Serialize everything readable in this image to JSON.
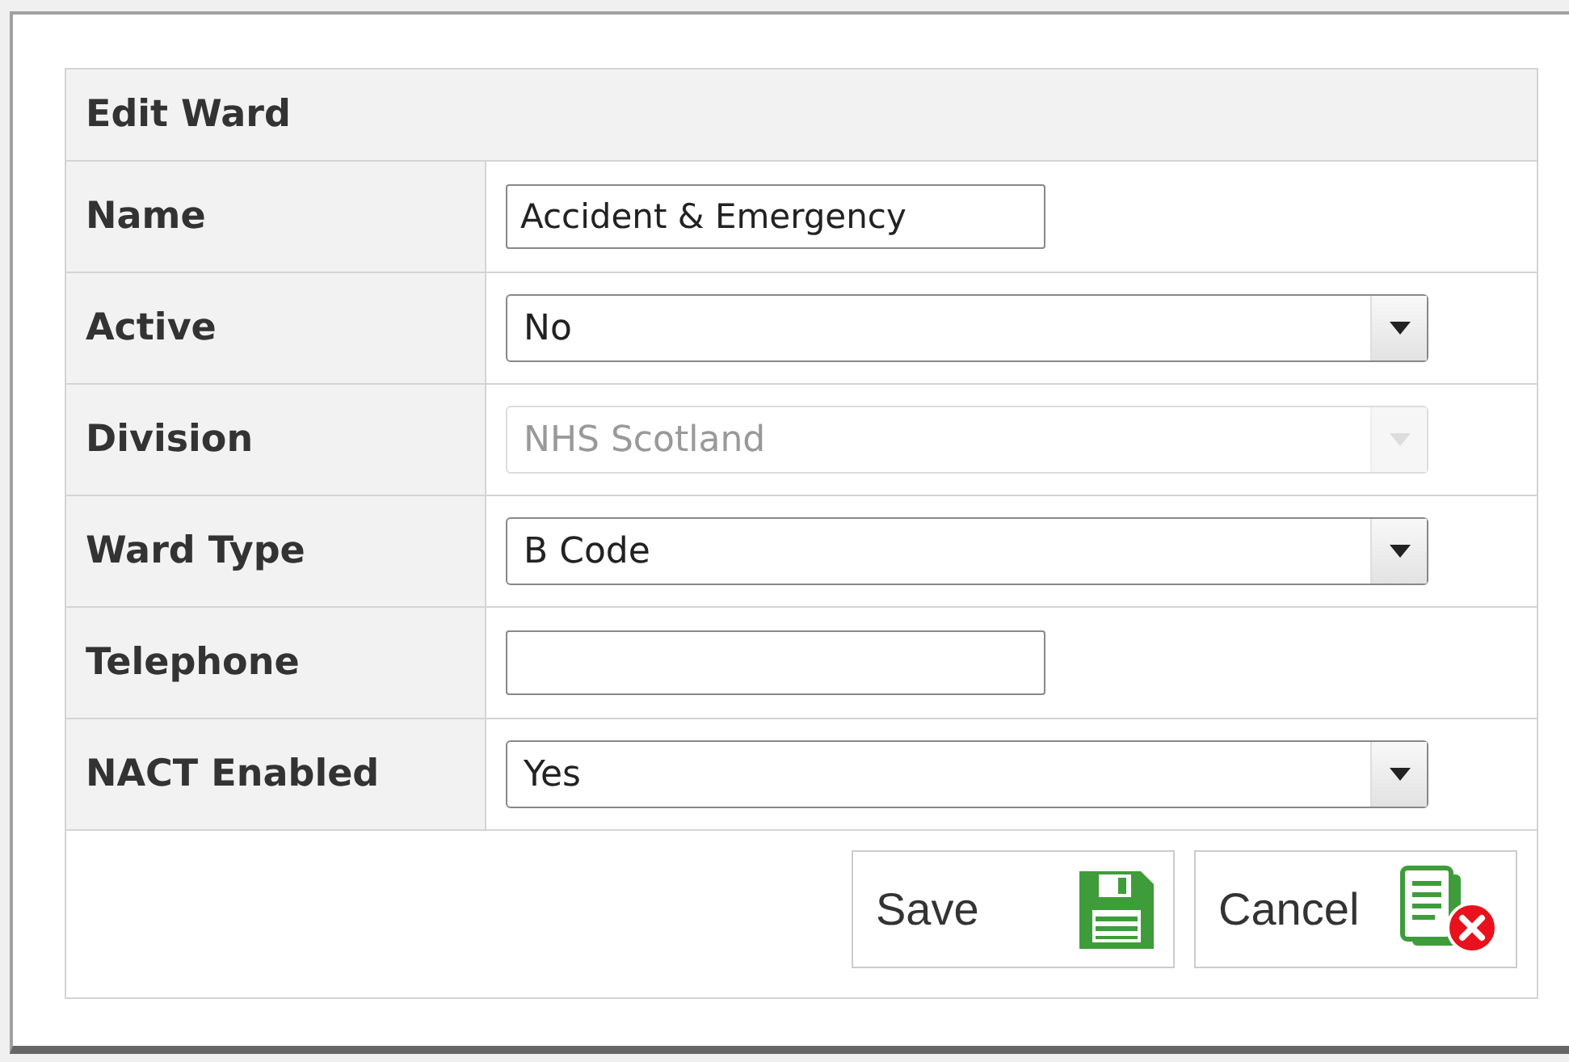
{
  "form": {
    "title": "Edit Ward",
    "fields": [
      {
        "label": "Name",
        "kind": "text",
        "value": "Accident & Emergency",
        "disabled": false
      },
      {
        "label": "Active",
        "kind": "select",
        "value": "No",
        "disabled": false
      },
      {
        "label": "Division",
        "kind": "select",
        "value": "NHS Scotland",
        "disabled": true
      },
      {
        "label": "Ward Type",
        "kind": "select",
        "value": "B Code",
        "disabled": false
      },
      {
        "label": "Telephone",
        "kind": "text",
        "disabled": false
      },
      {
        "label": "NACT Enabled",
        "kind": "select",
        "value": "Yes",
        "disabled": false
      }
    ],
    "buttons": [
      {
        "label": "Save",
        "kind": "save"
      },
      {
        "label": "Cancel",
        "kind": "cancel"
      }
    ]
  }
}
